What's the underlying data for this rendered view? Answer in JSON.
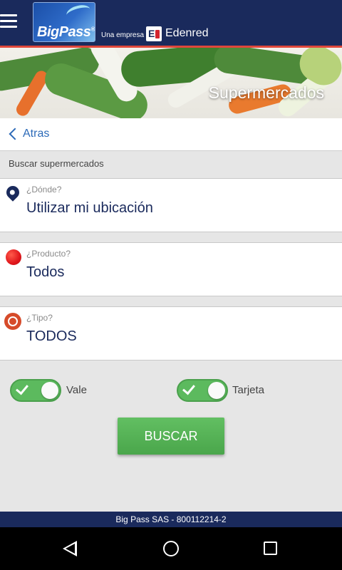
{
  "header": {
    "logo_text": "BigPass",
    "logo_mark": "®",
    "una_empresa": "Una empresa",
    "edenred_mark": "E",
    "edenred": "Edenred"
  },
  "banner": {
    "title": "Supermercados"
  },
  "nav": {
    "back_label": "Atras"
  },
  "section": {
    "label": "Buscar supermercados"
  },
  "fields": [
    {
      "hint": "¿Dónde?",
      "value": "Utilizar mi ubicación",
      "icon": "location-pin-icon"
    },
    {
      "hint": "¿Producto?",
      "value": "Todos",
      "icon": "tomato-icon"
    },
    {
      "hint": "¿Tipo?",
      "value": "TODOS",
      "icon": "plate-icon"
    }
  ],
  "toggles": [
    {
      "label": "Vale",
      "checked": true
    },
    {
      "label": "Tarjeta",
      "checked": true
    }
  ],
  "search_button": {
    "label": "BUSCAR"
  },
  "footer": {
    "text": "Big Pass SAS - 800112214-2"
  },
  "colors": {
    "primary": "#1a2a5c",
    "accent_link": "#2c6ab8",
    "button_green": "#5cba5e",
    "banner_red": "#e0473b"
  }
}
